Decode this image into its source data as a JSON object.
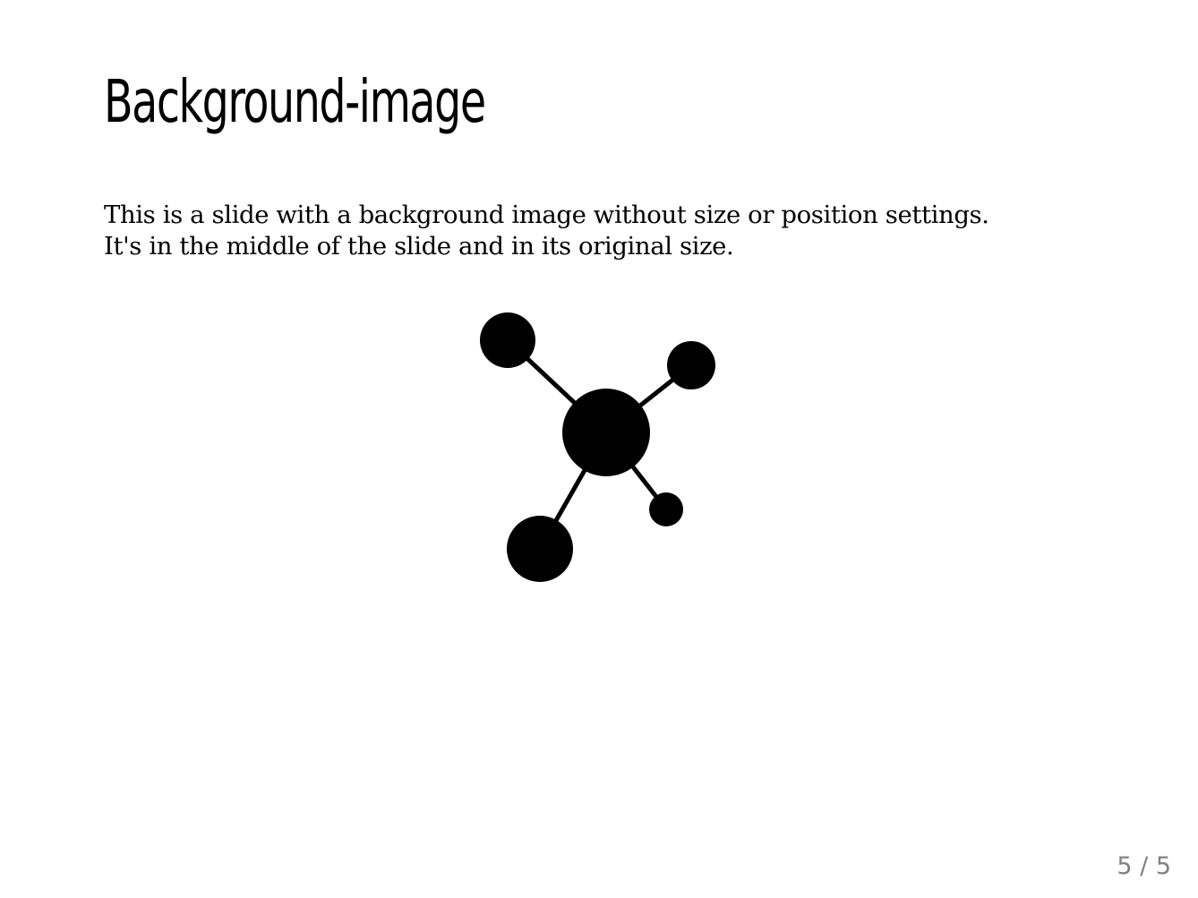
{
  "slide": {
    "title": "Background-image",
    "body_lines": [
      "This is a slide with a background image without size or position settings.",
      "It's in the middle of the slide and in its original size."
    ],
    "background_image_icon": "molecule-network-icon",
    "page_counter": "5 / 5"
  },
  "colors": {
    "text": "#000000",
    "counter": "#808080",
    "background": "#ffffff"
  }
}
